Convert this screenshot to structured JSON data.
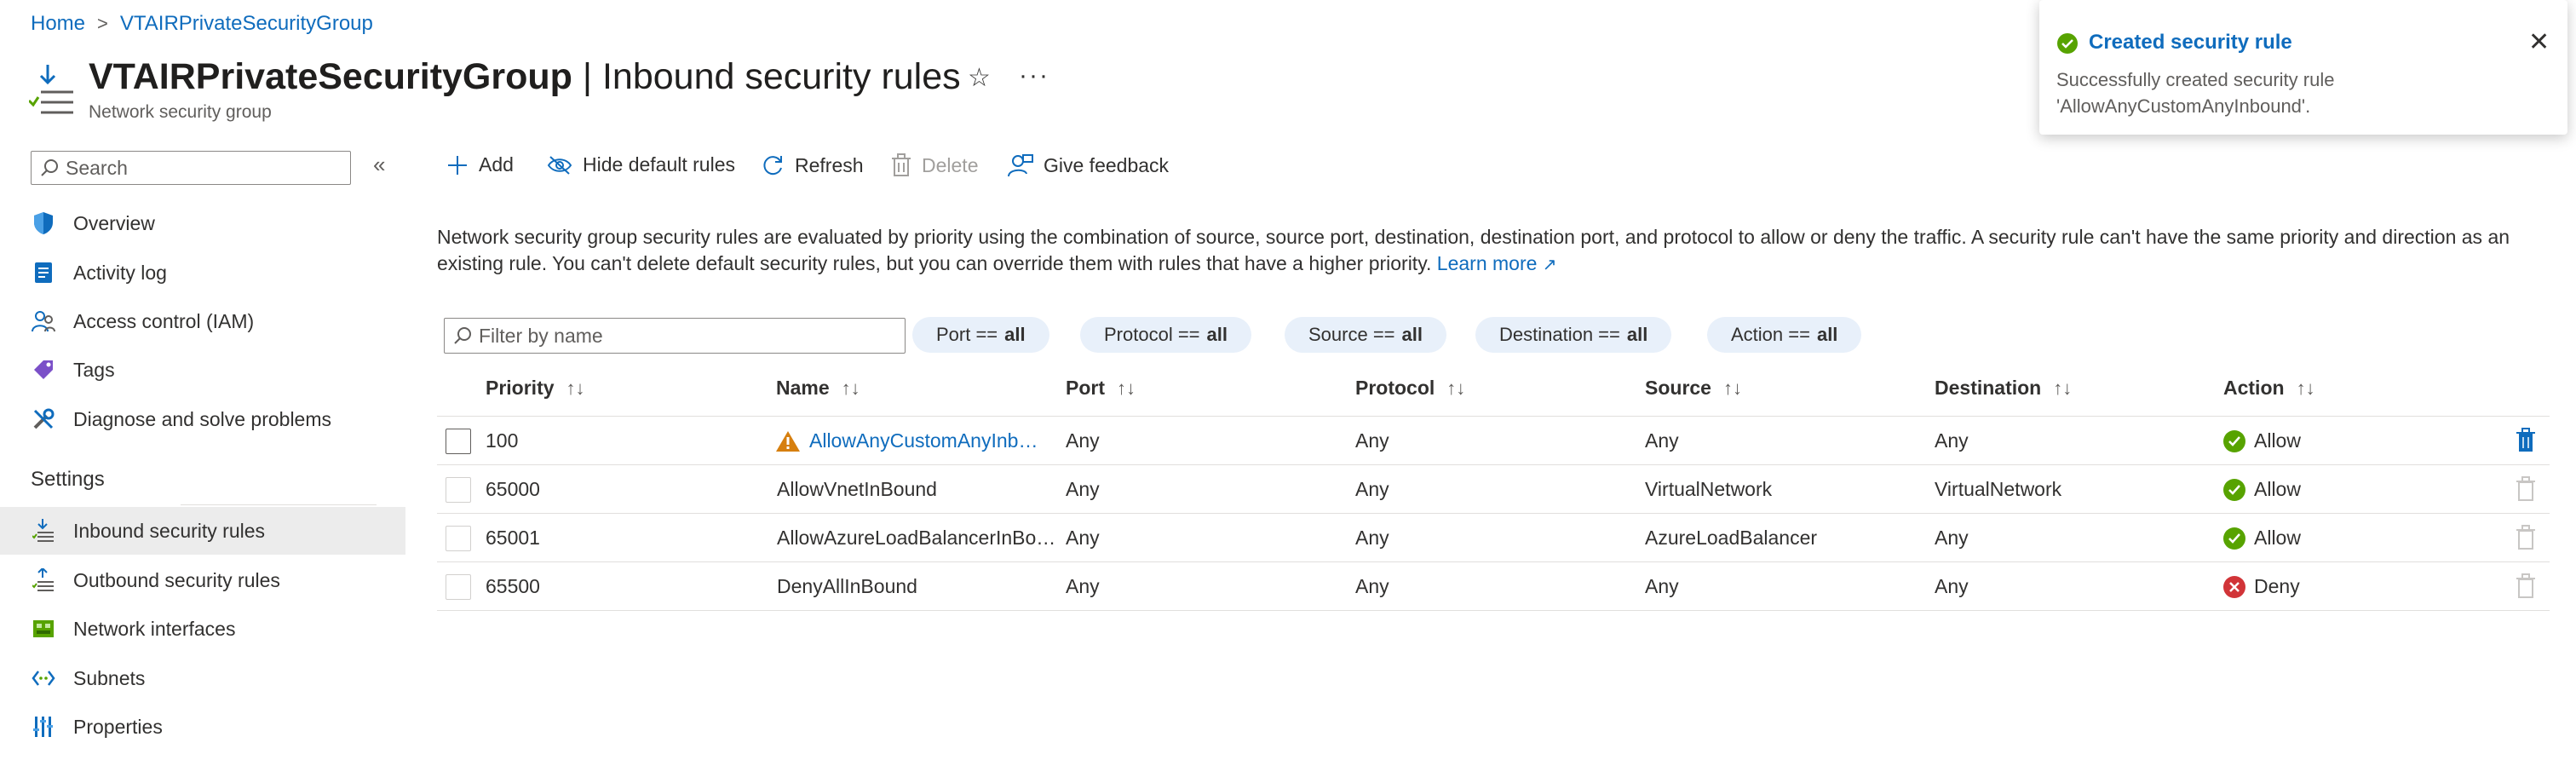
{
  "breadcrumb": {
    "home": "Home",
    "separator": ">",
    "current": "VTAIRPrivateSecurityGroup"
  },
  "header": {
    "title_bold": "VTAIRPrivateSecurityGroup",
    "title_rest": " | Inbound security rules",
    "subtitle": "Network security group",
    "icon": "nsg-inbound-icon"
  },
  "sidebar": {
    "search_placeholder": "Search",
    "collapse_glyph": "«",
    "items": [
      {
        "label": "Overview",
        "icon": "shield-icon"
      },
      {
        "label": "Activity log",
        "icon": "log-icon"
      },
      {
        "label": "Access control (IAM)",
        "icon": "people-icon"
      },
      {
        "label": "Tags",
        "icon": "tag-icon"
      },
      {
        "label": "Diagnose and solve problems",
        "icon": "wrench-icon"
      }
    ],
    "settings_header": "Settings",
    "settings_items": [
      {
        "label": "Inbound security rules",
        "icon": "inbound-icon",
        "active": true
      },
      {
        "label": "Outbound security rules",
        "icon": "outbound-icon",
        "active": false
      },
      {
        "label": "Network interfaces",
        "icon": "nic-icon",
        "active": false
      },
      {
        "label": "Subnets",
        "icon": "subnet-icon",
        "active": false
      },
      {
        "label": "Properties",
        "icon": "properties-icon",
        "active": false
      }
    ]
  },
  "toolbar": {
    "add": "Add",
    "hide_default": "Hide default rules",
    "refresh": "Refresh",
    "delete": "Delete",
    "feedback": "Give feedback"
  },
  "description": {
    "text": "Network security group security rules are evaluated by priority using the combination of source, source port, destination, destination port, and protocol to allow or deny the traffic. A security rule can't have the same priority and direction as an existing rule. You can't delete default security rules, but you can override them with rules that have a higher priority.",
    "link": "Learn more"
  },
  "filters": {
    "name_placeholder": "Filter by name",
    "pills": [
      {
        "label": "Port ==",
        "value": "all"
      },
      {
        "label": "Protocol ==",
        "value": "all"
      },
      {
        "label": "Source ==",
        "value": "all"
      },
      {
        "label": "Destination ==",
        "value": "all"
      },
      {
        "label": "Action ==",
        "value": "all"
      }
    ]
  },
  "table": {
    "columns": [
      "Priority",
      "Name",
      "Port",
      "Protocol",
      "Source",
      "Destination",
      "Action"
    ],
    "sort_glyph": "↑↓",
    "rows": [
      {
        "priority": "100",
        "name": "AllowAnyCustomAnyInb…",
        "port": "Any",
        "protocol": "Any",
        "source": "Any",
        "destination": "Any",
        "action": "Allow",
        "warning": true,
        "link": true
      },
      {
        "priority": "65000",
        "name": "AllowVnetInBound",
        "port": "Any",
        "protocol": "Any",
        "source": "VirtualNetwork",
        "destination": "VirtualNetwork",
        "action": "Allow",
        "warning": false,
        "link": false
      },
      {
        "priority": "65001",
        "name": "AllowAzureLoadBalancerInBo…",
        "port": "Any",
        "protocol": "Any",
        "source": "AzureLoadBalancer",
        "destination": "Any",
        "action": "Allow",
        "warning": false,
        "link": false
      },
      {
        "priority": "65500",
        "name": "DenyAllInBound",
        "port": "Any",
        "protocol": "Any",
        "source": "Any",
        "destination": "Any",
        "action": "Deny",
        "warning": false,
        "link": false
      }
    ]
  },
  "toast": {
    "title": "Created security rule",
    "message": "Successfully created security rule 'AllowAnyCustomAnyInbound'.",
    "close": "✕"
  },
  "colors": {
    "accent": "#0f6cbd",
    "allow": "#57a300",
    "deny": "#d13438",
    "warning": "#d67f0f"
  }
}
